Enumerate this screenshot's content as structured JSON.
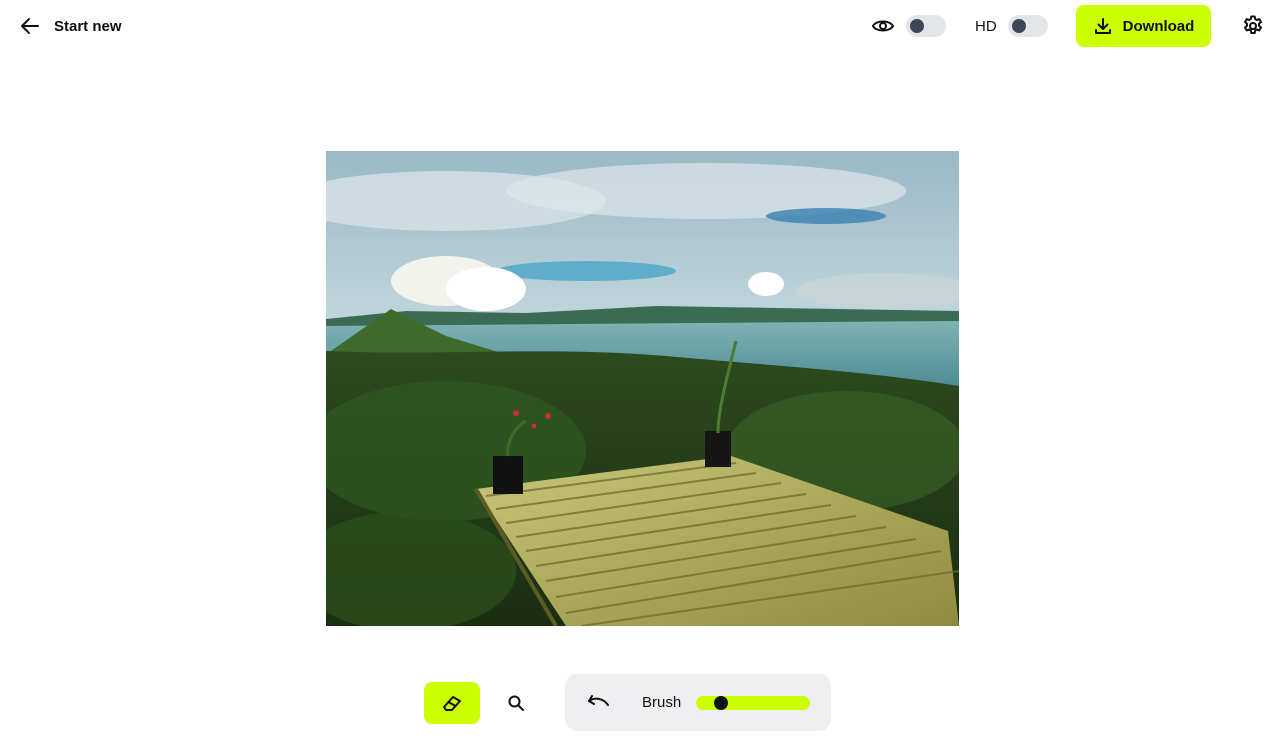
{
  "header": {
    "back_label": "Start new",
    "hd_label": "HD",
    "download_label": "Download",
    "preview_toggle_on": false,
    "hd_toggle_on": false
  },
  "toolbar": {
    "brush_label": "Brush",
    "brush_size_fraction": 0.18,
    "active_tool": "eraser"
  },
  "icons": {
    "back": "arrow-left-icon",
    "preview": "eye-icon",
    "download": "download-icon",
    "settings": "gear-icon",
    "eraser": "eraser-icon",
    "zoom": "magnifier-icon",
    "undo": "undo-icon"
  },
  "colors": {
    "accent": "#ccff00",
    "toggle_track": "#e4e5e9",
    "toggle_knob": "#3f4656",
    "panel_bg": "#efeff1"
  }
}
